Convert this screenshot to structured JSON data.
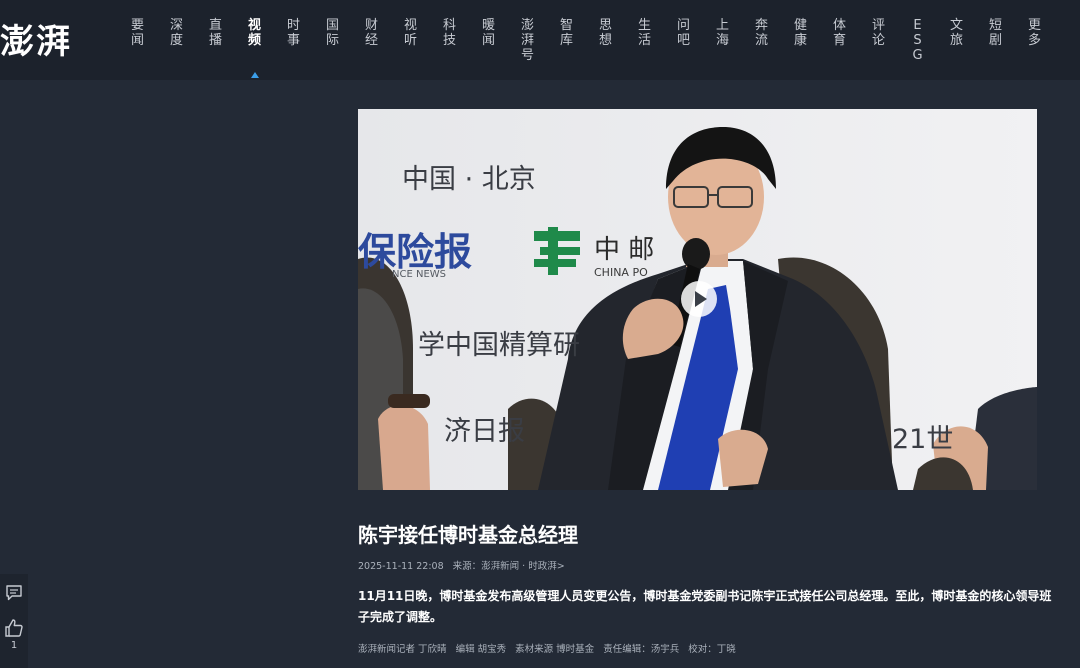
{
  "header": {
    "logo_text": "澎湃",
    "nav": [
      {
        "label": "要闻",
        "active": false
      },
      {
        "label": "深度",
        "active": false
      },
      {
        "label": "直播",
        "active": false
      },
      {
        "label": "视频",
        "active": true
      },
      {
        "label": "时事",
        "active": false
      },
      {
        "label": "国际",
        "active": false
      },
      {
        "label": "财经",
        "active": false
      },
      {
        "label": "视听",
        "active": false
      },
      {
        "label": "科技",
        "active": false
      },
      {
        "label": "暖闻",
        "active": false
      },
      {
        "label": "澎湃号",
        "active": false
      },
      {
        "label": "智库",
        "active": false
      },
      {
        "label": "思想",
        "active": false
      },
      {
        "label": "生活",
        "active": false
      },
      {
        "label": "问吧",
        "active": false
      },
      {
        "label": "上海",
        "active": false
      },
      {
        "label": "奔流",
        "active": false
      },
      {
        "label": "健康",
        "active": false
      },
      {
        "label": "体育",
        "active": false
      },
      {
        "label": "评论",
        "active": false
      },
      {
        "label": "ESG",
        "active": false
      },
      {
        "label": "文旅",
        "active": false
      },
      {
        "label": "短剧",
        "active": false
      },
      {
        "label": "更多",
        "active": false
      }
    ],
    "accent_color": "#3b9ee8"
  },
  "sidebar": {
    "comment_icon": "comment-icon",
    "like_icon": "thumbs-up-icon",
    "like_count": "1"
  },
  "hero": {
    "backdrop_texts": {
      "city": "中国 · 北京",
      "paper": "保险报",
      "paper_en": "NCE NEWS",
      "post_cn": "中 邮",
      "post_en": "CHINA PO",
      "actuary": "学中国精算研",
      "daily": "济日报",
      "century": "21世"
    },
    "play_icon": "play-icon"
  },
  "article": {
    "title": "陈宇接任博时基金总经理",
    "datetime": "2025-11-11 22:08",
    "source_label": "来源：",
    "source_link": "澎湃新闻 · 时政湃>",
    "summary": "11月11日晚，博时基金发布高级管理人员变更公告，博时基金党委副书记陈宇正式接任公司总经理。至此，博时基金的核心领导班子完成了调整。",
    "credits": {
      "reporter": "澎湃新闻记者 丁欣晴",
      "editor": "编辑 胡宝秀",
      "material": "素材来源 博时基金",
      "responsible": "责任编辑：汤宇兵",
      "proofread": "校对：丁晓"
    }
  }
}
